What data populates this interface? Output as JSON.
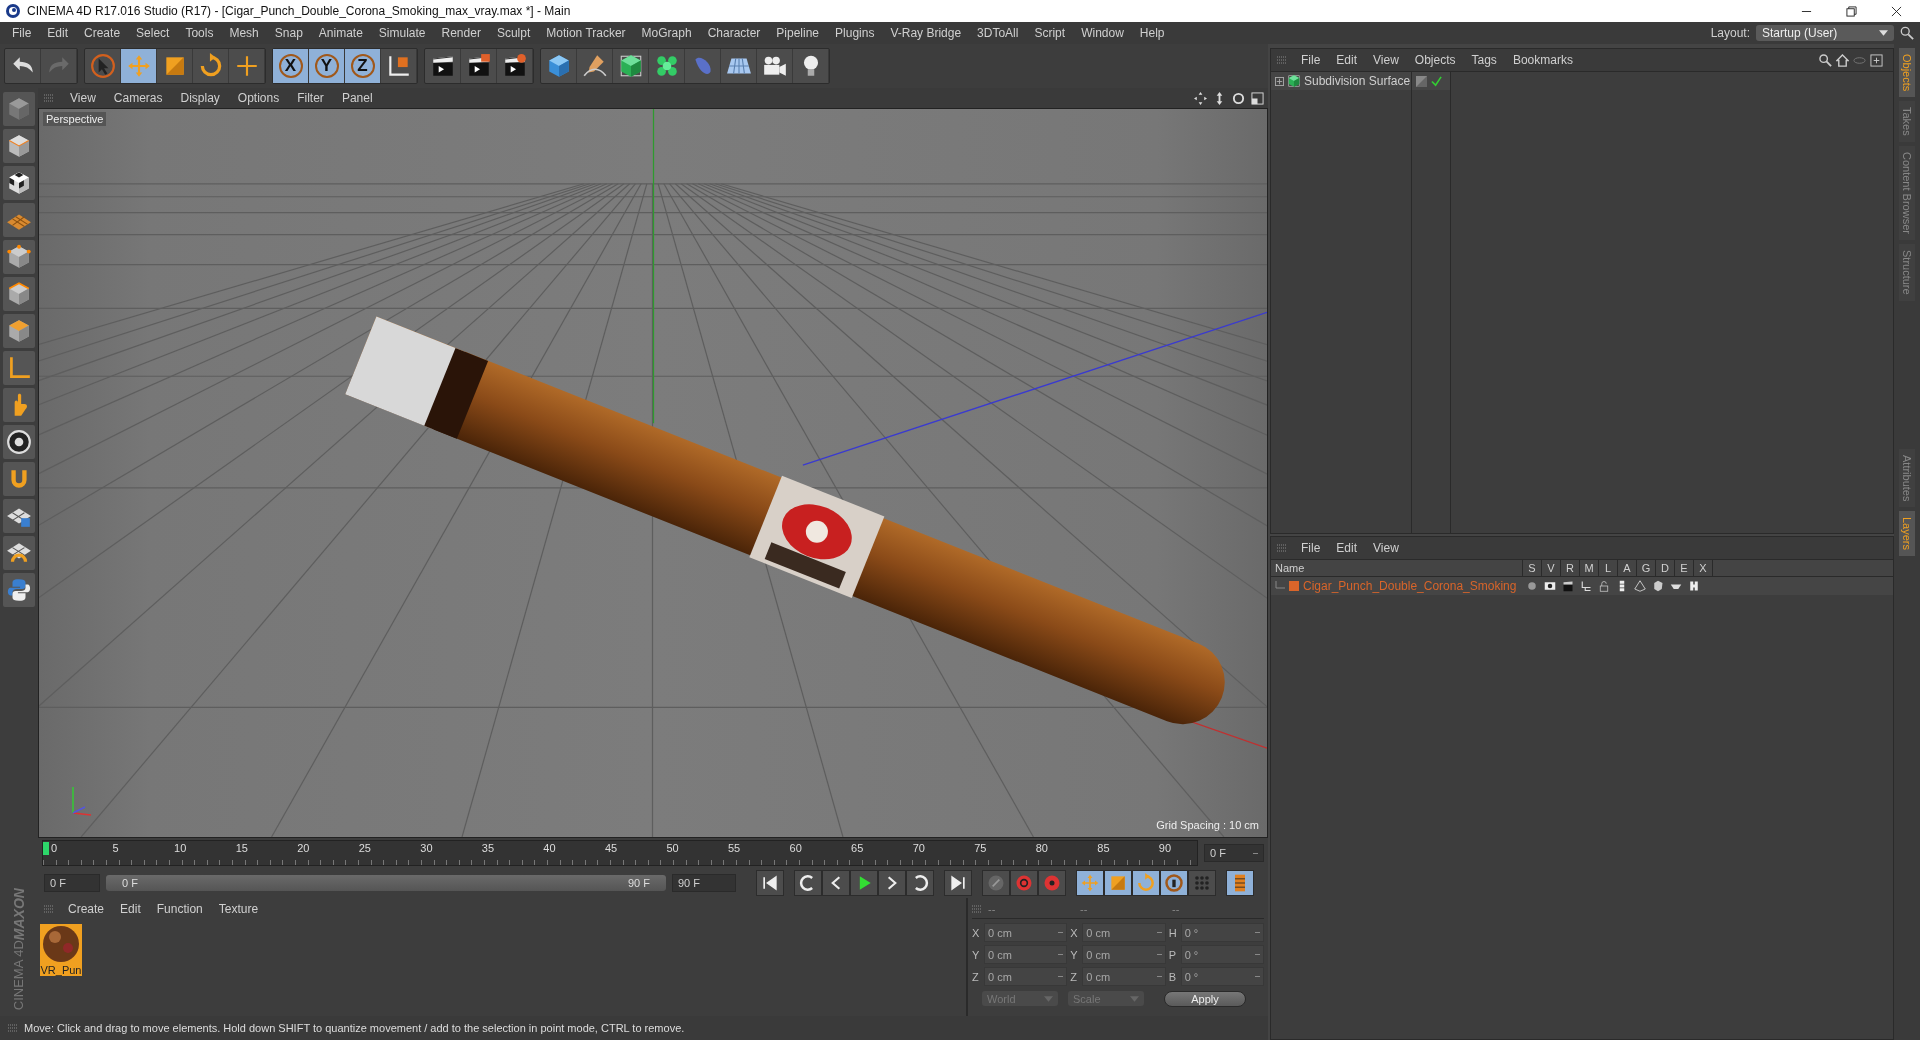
{
  "window": {
    "title": "CINEMA 4D R17.016 Studio (R17) - [Cigar_Punch_Double_Corona_Smoking_max_vray.max *] - Main"
  },
  "menu": [
    "File",
    "Edit",
    "Create",
    "Select",
    "Tools",
    "Mesh",
    "Snap",
    "Animate",
    "Simulate",
    "Render",
    "Sculpt",
    "Motion Tracker",
    "MoGraph",
    "Character",
    "Pipeline",
    "Plugins",
    "V-Ray Bridge",
    "3DToAll",
    "Script",
    "Window",
    "Help"
  ],
  "layout": {
    "label": "Layout:",
    "value": "Startup (User)"
  },
  "toolbar": [
    [
      {
        "kind": "undo",
        "selected": false
      },
      {
        "kind": "redo",
        "selected": false
      }
    ],
    [
      {
        "kind": "select",
        "selected": false
      },
      {
        "kind": "move",
        "selected": true
      },
      {
        "kind": "scale",
        "selected": false
      },
      {
        "kind": "rotate",
        "selected": false
      },
      {
        "kind": "add",
        "selected": false
      }
    ],
    [
      {
        "kind": "axis",
        "label": "X",
        "selected": true
      },
      {
        "kind": "axis",
        "label": "Y",
        "selected": true
      },
      {
        "kind": "axis",
        "label": "Z",
        "selected": true
      },
      {
        "kind": "coord",
        "selected": false
      }
    ],
    [
      {
        "kind": "render",
        "selected": false
      },
      {
        "kind": "render-view",
        "selected": false
      },
      {
        "kind": "render-settings",
        "selected": false
      }
    ],
    [
      {
        "kind": "cube",
        "selected": false
      },
      {
        "kind": "pen",
        "selected": false
      },
      {
        "kind": "subdiv",
        "selected": false
      },
      {
        "kind": "cloner",
        "selected": false
      },
      {
        "kind": "deformer",
        "selected": false
      },
      {
        "kind": "floor",
        "selected": false
      },
      {
        "kind": "camera",
        "selected": false
      },
      {
        "kind": "light",
        "selected": false
      }
    ]
  ],
  "left_tools": [
    {
      "kind": "faded-cube"
    },
    {
      "kind": "model"
    },
    {
      "kind": "texture"
    },
    {
      "kind": "workplane"
    },
    {
      "kind": "points"
    },
    {
      "kind": "edges"
    },
    {
      "kind": "polygons"
    },
    {
      "kind": "axis-l"
    },
    {
      "kind": "tweak"
    },
    {
      "kind": "solo"
    },
    {
      "kind": "magnet"
    },
    {
      "kind": "lock-grid"
    },
    {
      "kind": "snap-grid"
    },
    {
      "kind": "python"
    }
  ],
  "logo": {
    "brand": "MAXON",
    "product": "CINEMA 4D"
  },
  "viewport": {
    "menu": [
      "View",
      "Cameras",
      "Display",
      "Options",
      "Filter",
      "Panel"
    ],
    "camera": "Perspective",
    "grid_spacing": "Grid Spacing : 10 cm"
  },
  "timeline": {
    "ticks": [
      "0",
      "5",
      "10",
      "15",
      "20",
      "25",
      "30",
      "35",
      "40",
      "45",
      "50",
      "55",
      "60",
      "65",
      "70",
      "75",
      "80",
      "85",
      "90"
    ],
    "level": 0,
    "current": "0 F"
  },
  "transport": {
    "level": 1,
    "start": "0 F",
    "range_start": "0 F",
    "range_end": "90 F",
    "end": "90 F"
  },
  "materials": {
    "menu": [
      "Create",
      "Edit",
      "Function",
      "Texture"
    ],
    "items": [
      {
        "name": "VR_Pun",
        "selected": true
      }
    ]
  },
  "coords": {
    "columns": [
      {
        "header": "--",
        "rows": [
          {
            "label": "X",
            "value": "0 cm"
          },
          {
            "label": "Y",
            "value": "0 cm"
          },
          {
            "label": "Z",
            "value": "0 cm"
          }
        ]
      },
      {
        "header": "--",
        "rows": [
          {
            "label": "X",
            "value": "0 cm"
          },
          {
            "label": "Y",
            "value": "0 cm"
          },
          {
            "label": "Z",
            "value": "0 cm"
          }
        ]
      },
      {
        "header": "--",
        "rows": [
          {
            "label": "H",
            "value": "0 °"
          },
          {
            "label": "P",
            "value": "0 °"
          },
          {
            "label": "B",
            "value": "0 °"
          }
        ]
      }
    ],
    "dropdowns": [
      "World",
      "Scale"
    ],
    "apply": "Apply"
  },
  "status_bar": "Move: Click and drag to move elements. Hold down SHIFT to quantize movement / add to the selection in point mode, CTRL to remove.",
  "objects": {
    "menu": [
      "File",
      "Edit",
      "View",
      "Objects",
      "Tags",
      "Bookmarks"
    ],
    "items": [
      {
        "name": "Subdivision Surface",
        "enabled": true
      }
    ]
  },
  "layers": {
    "menu": [
      "File",
      "Edit",
      "View"
    ],
    "name_column": "Name",
    "flags": [
      "S",
      "V",
      "R",
      "M",
      "L",
      "A",
      "G",
      "D",
      "E",
      "X"
    ],
    "rows": [
      {
        "name": "Cigar_Punch_Double_Corona_Smoking",
        "color": "#d9652a"
      }
    ]
  },
  "side_tabs_top": [
    {
      "label": "Objects",
      "selected": true
    },
    {
      "label": "Takes",
      "selected": false
    },
    {
      "label": "Content Browser",
      "selected": false
    },
    {
      "label": "Structure",
      "selected": false
    }
  ],
  "side_tabs_bottom": [
    {
      "label": "Attributes",
      "selected": false
    },
    {
      "label": "Layers",
      "selected": true
    }
  ]
}
